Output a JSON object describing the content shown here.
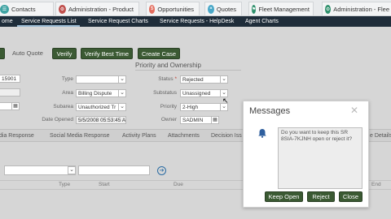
{
  "tabs": [
    {
      "label": "Contacts",
      "icon": "contacts-icon",
      "color": "#3fa3a3"
    },
    {
      "label": "Administration - Product",
      "icon": "admin-product-icon",
      "color": "#c0504d"
    },
    {
      "label": "Opportunities",
      "icon": "opportunities-icon",
      "color": "#e36c5d"
    },
    {
      "label": "Quotes",
      "icon": "quotes-icon",
      "color": "#4aa8c8"
    },
    {
      "label": "Fleet Management",
      "icon": "fleet-icon",
      "color": "#2d8f6b"
    },
    {
      "label": "Administration - Flee",
      "icon": "admin-fleet-icon",
      "color": "#2d8f6b"
    }
  ],
  "nav": {
    "home": "ome",
    "items": [
      "Service Requests List",
      "Service Request Charts",
      "Service Requests - HelpDesk",
      "Agent Charts"
    ],
    "active": "Service Requests List"
  },
  "toolbar": {
    "auto_quote": "Auto Quote",
    "verify": "Verify",
    "verify_best_time": "Verify Best Time",
    "create_case": "Create Case"
  },
  "section_title": "Priority and Ownership",
  "form": {
    "sr_number": "15901",
    "type_label": "Type",
    "type_value": "",
    "area_label": "Area",
    "area_value": "Billing Dispute",
    "subarea_label": "Subarea",
    "subarea_value": "Unauthorized Tr",
    "date_opened_label": "Date Opened",
    "date_opened_value": "5/5/2008 05:53:45 A",
    "status_label": "Status",
    "status_value": "Rejected",
    "substatus_label": "Substatus",
    "substatus_value": "Unassigned",
    "priority_label": "Priority",
    "priority_value": "2-High",
    "owner_label": "Owner",
    "owner_value": "SADMIN"
  },
  "subtabs": [
    "dia Response",
    "Social Media Response",
    "Activity Plans",
    "Attachments",
    "Decision Iss",
    "e Details"
  ],
  "list_columns": [
    "Type",
    "Start",
    "Due",
    "End"
  ],
  "modal": {
    "title": "Messages",
    "message": "Do you want to keep this SR 8SIA-7KJNH open or reject it?",
    "keep_open": "Keep Open",
    "reject": "Reject",
    "close": "Close"
  }
}
